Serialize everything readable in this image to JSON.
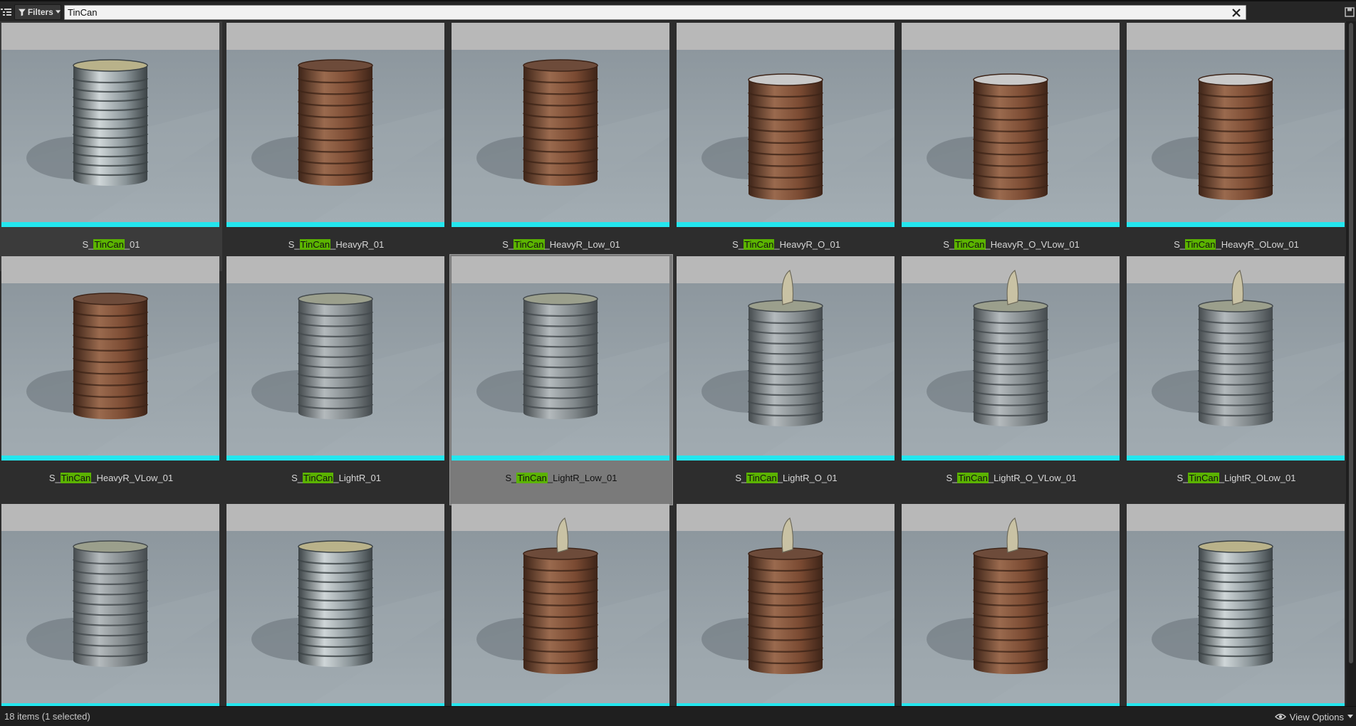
{
  "toolbar": {
    "filters_label": "Filters",
    "search_value": "TinCan"
  },
  "tiles": [
    {
      "prefix": "S_",
      "match": "TinCan",
      "suffix": "_01",
      "look": "clean",
      "tab": false
    },
    {
      "prefix": "S_",
      "match": "TinCan",
      "suffix": "_HeavyR_01",
      "look": "rusty",
      "tab": false
    },
    {
      "prefix": "S_",
      "match": "TinCan",
      "suffix": "_HeavyR_Low_01",
      "look": "rusty",
      "tab": false
    },
    {
      "prefix": "S_",
      "match": "TinCan",
      "suffix": "_HeavyR_O_01",
      "look": "rusty-open",
      "tab": false
    },
    {
      "prefix": "S_",
      "match": "TinCan",
      "suffix": "_HeavyR_O_VLow_01",
      "look": "rusty-open",
      "tab": false
    },
    {
      "prefix": "S_",
      "match": "TinCan",
      "suffix": "_HeavyR_OLow_01",
      "look": "rusty-open",
      "tab": false
    },
    {
      "prefix": "S_",
      "match": "TinCan",
      "suffix": "_HeavyR_VLow_01",
      "look": "rusty",
      "tab": false
    },
    {
      "prefix": "S_",
      "match": "TinCan",
      "suffix": "_LightR_01",
      "look": "grey",
      "tab": false
    },
    {
      "prefix": "S_",
      "match": "TinCan",
      "suffix": "_LightR_Low_01",
      "look": "grey",
      "tab": false
    },
    {
      "prefix": "S_",
      "match": "TinCan",
      "suffix": "_LightR_O_01",
      "look": "grey",
      "tab": true
    },
    {
      "prefix": "S_",
      "match": "TinCan",
      "suffix": "_LightR_O_VLow_01",
      "look": "grey",
      "tab": true
    },
    {
      "prefix": "S_",
      "match": "TinCan",
      "suffix": "_LightR_OLow_01",
      "look": "grey",
      "tab": true
    },
    {
      "prefix": "",
      "match": "",
      "suffix": "",
      "look": "grey",
      "tab": false
    },
    {
      "prefix": "",
      "match": "",
      "suffix": "",
      "look": "clean",
      "tab": false
    },
    {
      "prefix": "",
      "match": "",
      "suffix": "",
      "look": "rusty",
      "tab": true
    },
    {
      "prefix": "",
      "match": "",
      "suffix": "",
      "look": "rusty",
      "tab": true
    },
    {
      "prefix": "",
      "match": "",
      "suffix": "",
      "look": "rusty",
      "tab": true
    },
    {
      "prefix": "",
      "match": "",
      "suffix": "",
      "look": "clean",
      "tab": false
    }
  ],
  "selected_index": 8,
  "hovered_index": 0,
  "status": {
    "item_count": "18 items (1 selected)",
    "view_options_label": "View Options"
  },
  "colors": {
    "type_bar": "#24e6ee",
    "search_highlight": "#5bb300",
    "rusty_body": "#7a4a32",
    "clean_body": "#8c969a",
    "grey_body": "#7f8689"
  },
  "icons": {
    "filter": "funnel-icon",
    "clear": "close-icon",
    "view_options": "eye-icon"
  }
}
